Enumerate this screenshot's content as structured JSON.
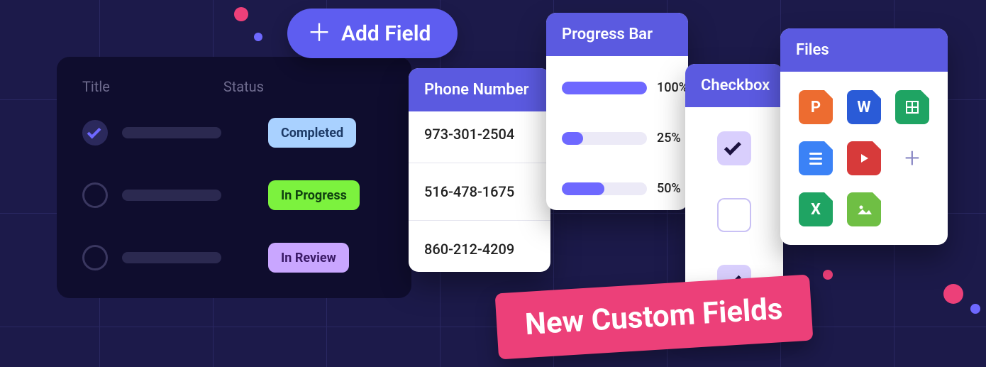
{
  "add_field_label": "Add Field",
  "banner_text": "New Custom Fields",
  "task_table": {
    "headers": {
      "title": "Title",
      "status": "Status"
    },
    "rows": [
      {
        "checked": true,
        "status_label": "Completed",
        "status_kind": "completed"
      },
      {
        "checked": false,
        "status_label": "In Progress",
        "status_kind": "inprogress"
      },
      {
        "checked": false,
        "status_label": "In Review",
        "status_kind": "inreview"
      }
    ]
  },
  "cards": {
    "phone": {
      "title": "Phone Number",
      "values": [
        "973-301-2504",
        "516-478-1675",
        "860-212-4209"
      ]
    },
    "progress": {
      "title": "Progress Bar",
      "items": [
        {
          "percent": 100,
          "label": "100%"
        },
        {
          "percent": 25,
          "label": "25%"
        },
        {
          "percent": 50,
          "label": "50%"
        }
      ]
    },
    "checkbox": {
      "title": "Checkbox",
      "items": [
        {
          "checked": true
        },
        {
          "checked": false
        },
        {
          "checked": true
        }
      ]
    },
    "files": {
      "title": "Files",
      "items": [
        {
          "kind": "powerpoint",
          "letter": "P",
          "color": "#ed6c30"
        },
        {
          "kind": "word",
          "letter": "W",
          "color": "#2a5bd7"
        },
        {
          "kind": "sheets",
          "letter": "",
          "color": "#1fa463",
          "icon": "grid"
        },
        {
          "kind": "docs",
          "letter": "",
          "color": "#3b82f6",
          "icon": "lines"
        },
        {
          "kind": "video",
          "letter": "",
          "color": "#d73a3a",
          "icon": "play"
        },
        {
          "kind": "add",
          "letter": "+",
          "color": ""
        },
        {
          "kind": "excel",
          "letter": "X",
          "color": "#1fa463"
        },
        {
          "kind": "image",
          "letter": "",
          "color": "#6fbf44",
          "icon": "image"
        }
      ]
    }
  }
}
